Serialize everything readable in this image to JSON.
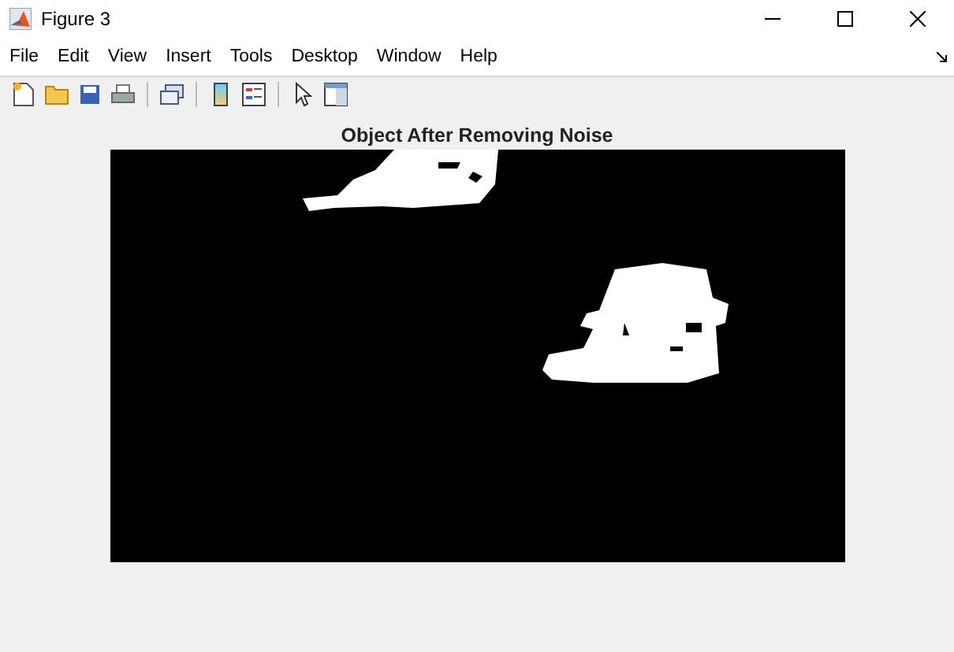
{
  "window": {
    "title": "Figure 3"
  },
  "menu": [
    "File",
    "Edit",
    "View",
    "Insert",
    "Tools",
    "Desktop",
    "Window",
    "Help"
  ],
  "toolbar": [
    {
      "kind": "new"
    },
    {
      "kind": "open"
    },
    {
      "kind": "save"
    },
    {
      "kind": "print"
    },
    {
      "kind": "sep"
    },
    {
      "kind": "link"
    },
    {
      "kind": "sep"
    },
    {
      "kind": "colorbar"
    },
    {
      "kind": "legend"
    },
    {
      "kind": "sep"
    },
    {
      "kind": "pointer"
    },
    {
      "kind": "inspector"
    }
  ],
  "axes": {
    "title": "Object After Removing Noise"
  }
}
